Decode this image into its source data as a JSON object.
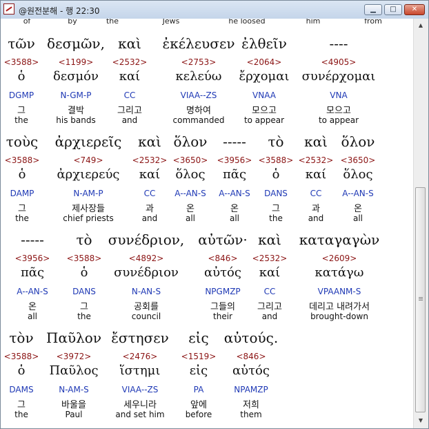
{
  "window": {
    "title": "@원전분해 - 행 22:30",
    "controls": {
      "minimize": "▁",
      "maximize": "□",
      "close": "✕"
    }
  },
  "header_gloss": [
    "of",
    "by",
    "the",
    "Jews",
    "he loosed",
    "him",
    "from"
  ],
  "verses": [
    {
      "words": [
        {
          "greek": "τῶν",
          "strong": "<3588>",
          "lemma": "ὁ",
          "morph": "DGMP",
          "korean": "그",
          "english": "the"
        },
        {
          "greek": "δεσμῶν,",
          "strong": "<1199>",
          "lemma": "δεσμόν",
          "morph": "N-GM-P",
          "korean": "결박",
          "english": "his bands"
        },
        {
          "greek": "καὶ",
          "strong": "<2532>",
          "lemma": "καί",
          "morph": "CC",
          "korean": "그리고",
          "english": "and"
        },
        {
          "greek": "ἐκέλευσεν",
          "strong": "<2753>",
          "lemma": "κελεύω",
          "morph": "VIAA--ZS",
          "korean": "명하여",
          "english": "commanded"
        },
        {
          "greek": "ἐλθεῖν",
          "strong": "<2064>",
          "lemma": "ἔρχομαι",
          "morph": "VNAA",
          "korean": "모으고",
          "english": "to appear"
        },
        {
          "greek": "----",
          "strong": "<4905>",
          "lemma": "συνέρχομαι",
          "morph": "VNA",
          "korean": "모으고",
          "english": "to appear"
        }
      ]
    },
    {
      "words": [
        {
          "greek": "τοὺς",
          "strong": "<3588>",
          "lemma": "ὁ",
          "morph": "DAMP",
          "korean": "그",
          "english": "the"
        },
        {
          "greek": "ἀρχιερεῖς",
          "strong": "<749>",
          "lemma": "ἀρχιερεύς",
          "morph": "N-AM-P",
          "korean": "제사장들",
          "english": "chief priests"
        },
        {
          "greek": "καὶ",
          "strong": "<2532>",
          "lemma": "καί",
          "morph": "CC",
          "korean": "과",
          "english": "and"
        },
        {
          "greek": "ὅλον",
          "strong": "<3650>",
          "lemma": "ὅλος",
          "morph": "A--AN-S",
          "korean": "온",
          "english": "all"
        },
        {
          "greek": "-----",
          "strong": "<3956>",
          "lemma": "πᾶς",
          "morph": "A--AN-S",
          "korean": "온",
          "english": "all"
        },
        {
          "greek": "τὸ",
          "strong": "<3588>",
          "lemma": "ὁ",
          "morph": "DANS",
          "korean": "그",
          "english": "the"
        },
        {
          "greek": "καὶ",
          "strong": "<2532>",
          "lemma": "καί",
          "morph": "CC",
          "korean": "과",
          "english": "and"
        },
        {
          "greek": "ὅλον",
          "strong": "<3650>",
          "lemma": "ὅλος",
          "morph": "A--AN-S",
          "korean": "온",
          "english": "all"
        }
      ]
    },
    {
      "words": [
        {
          "greek": "-----",
          "strong": "<3956>",
          "lemma": "πᾶς",
          "morph": "A--AN-S",
          "korean": "온",
          "english": "all"
        },
        {
          "greek": "τὸ",
          "strong": "<3588>",
          "lemma": "ὁ",
          "morph": "DANS",
          "korean": "그",
          "english": "the"
        },
        {
          "greek": "συνέδριον,",
          "strong": "<4892>",
          "lemma": "συνέδριον",
          "morph": "N-AN-S",
          "korean": "공회를",
          "english": "council"
        },
        {
          "greek": "αὐτῶν·",
          "strong": "<846>",
          "lemma": "αὐτός",
          "morph": "NPGMZP",
          "korean": "그들의",
          "english": "their"
        },
        {
          "greek": "καὶ",
          "strong": "<2532>",
          "lemma": "καί",
          "morph": "CC",
          "korean": "그리고",
          "english": "and"
        },
        {
          "greek": "καταγαγὼν",
          "strong": "<2609>",
          "lemma": "κατάγω",
          "morph": "VPAANM-S",
          "korean": "데리고 내려가서",
          "english": "brought-down"
        }
      ]
    },
    {
      "words": [
        {
          "greek": "τὸν",
          "strong": "<3588>",
          "lemma": "ὁ",
          "morph": "DAMS",
          "korean": "그",
          "english": "the"
        },
        {
          "greek": "Παῦλον",
          "strong": "<3972>",
          "lemma": "Παῦλος",
          "morph": "N-AM-S",
          "korean": "바울을",
          "english": "Paul"
        },
        {
          "greek": "ἔστησεν",
          "strong": "<2476>",
          "lemma": "ἵστημι",
          "morph": "VIAA--ZS",
          "korean": "세우니라",
          "english": "and set him"
        },
        {
          "greek": "εἰς",
          "strong": "<1519>",
          "lemma": "εἰς",
          "morph": "PA",
          "korean": "앞에",
          "english": "before"
        },
        {
          "greek": "αὐτούς.",
          "strong": "<846>",
          "lemma": "αὐτός",
          "morph": "NPAMZP",
          "korean": "저희",
          "english": "them"
        }
      ]
    }
  ],
  "scrollbar": {
    "up": "▲",
    "down": "▼",
    "position": 0.6
  }
}
